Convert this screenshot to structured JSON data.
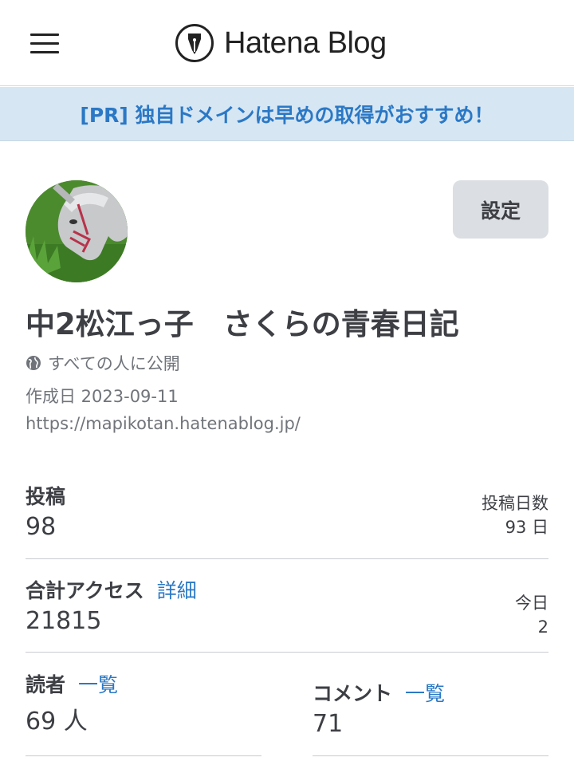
{
  "header": {
    "logo_text": "Hatena Blog"
  },
  "pr_banner": {
    "text": "[PR] 独自ドメインは早めの取得がおすすめ！"
  },
  "profile": {
    "settings_label": "設定",
    "blog_title": "中2松江っ子　さくらの青春日記",
    "visibility": "すべての人に公開",
    "created": "作成日 2023-09-11",
    "url": "https://mapikotan.hatenablog.jp/"
  },
  "stats": {
    "posts": {
      "label": "投稿",
      "value": "98",
      "sub_label": "投稿日数",
      "sub_value": "93 日"
    },
    "access": {
      "label": "合計アクセス",
      "link": "詳細",
      "value": "21815",
      "sub_label": "今日",
      "sub_value": "2"
    },
    "readers": {
      "label": "読者",
      "link": "一覧",
      "value": "69 人"
    },
    "comments": {
      "label": "コメント",
      "link": "一覧",
      "value": "71"
    }
  },
  "colors": {
    "accent": "#2b78c5",
    "banner_bg": "#d6e6f3",
    "button_bg": "#dbdee2"
  },
  "icons": [
    "hamburger-menu-icon",
    "hatena-pen-logo-icon",
    "globe-icon"
  ]
}
